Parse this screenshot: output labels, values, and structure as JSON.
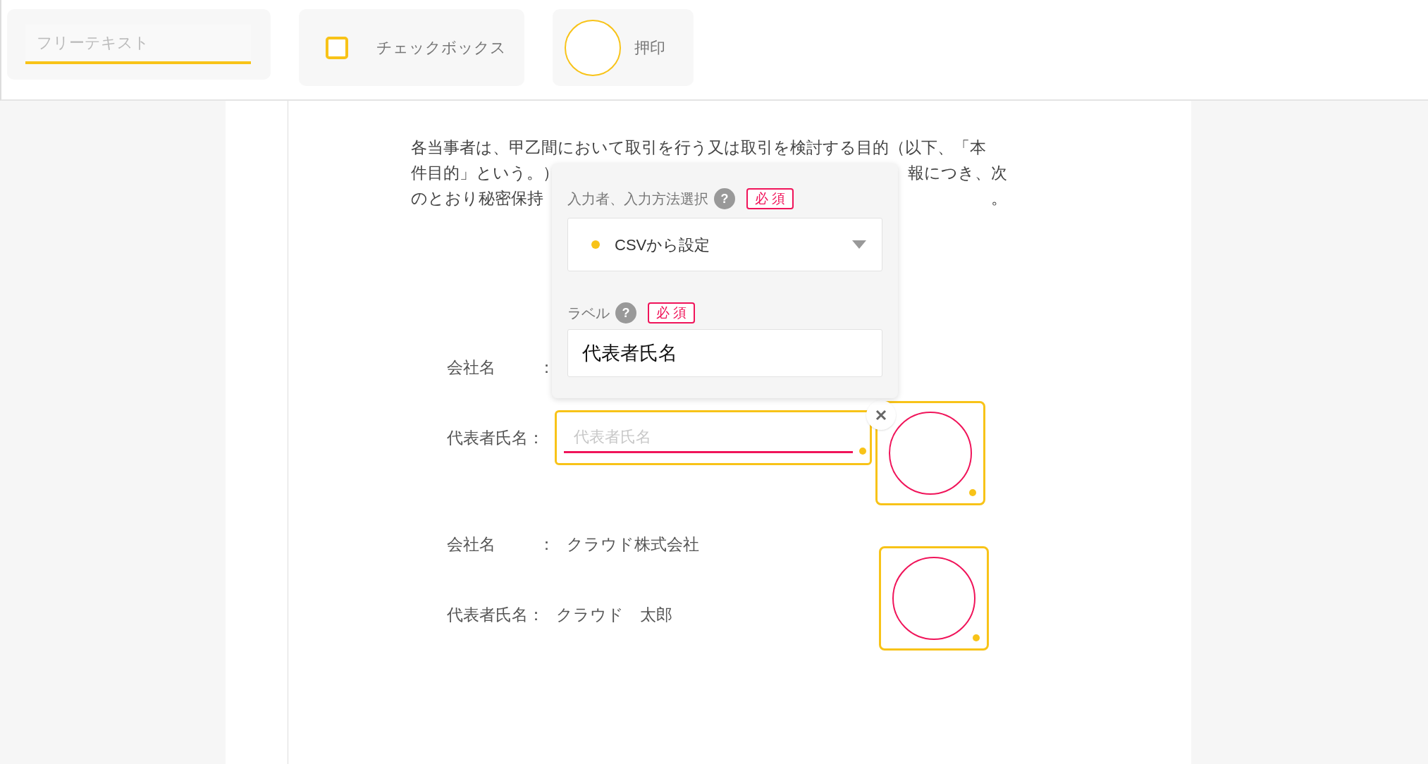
{
  "palette": [
    {
      "kind": "text",
      "placeholder": "フリーテキスト"
    },
    {
      "kind": "checkbox",
      "label": "チェックボックス",
      "checked": false
    },
    {
      "kind": "stamp",
      "label": "押印"
    }
  ],
  "document": {
    "paragraph": [
      [
        "各当事者は、甲乙間において取引を行う又は取引を検討する目的（以下、「本"
      ],
      [
        "件目的」という。）",
        "報につき、次"
      ],
      [
        "のとおり秘密保持",
        "。"
      ]
    ],
    "signers": [
      {
        "company_label": "会社名",
        "company_sep": "：",
        "name_label": "代表者氏名",
        "name_sep": "：",
        "name_field": {
          "placeholder": "代表者氏名"
        }
      },
      {
        "company_label": "会社名",
        "company_sep": "：",
        "company": "クラウド株式会社",
        "name_label": "代表者氏名",
        "name_sep": "：",
        "name": "クラウド　太郎"
      }
    ]
  },
  "popup": {
    "fields": [
      {
        "kind": "select",
        "label": "入力者、入力方法選択",
        "help": "?",
        "required": "必 須",
        "value": "CSVから設定"
      },
      {
        "kind": "input",
        "label": "ラベル",
        "help": "?",
        "required": "必 須",
        "value": "代表者氏名"
      }
    ]
  }
}
